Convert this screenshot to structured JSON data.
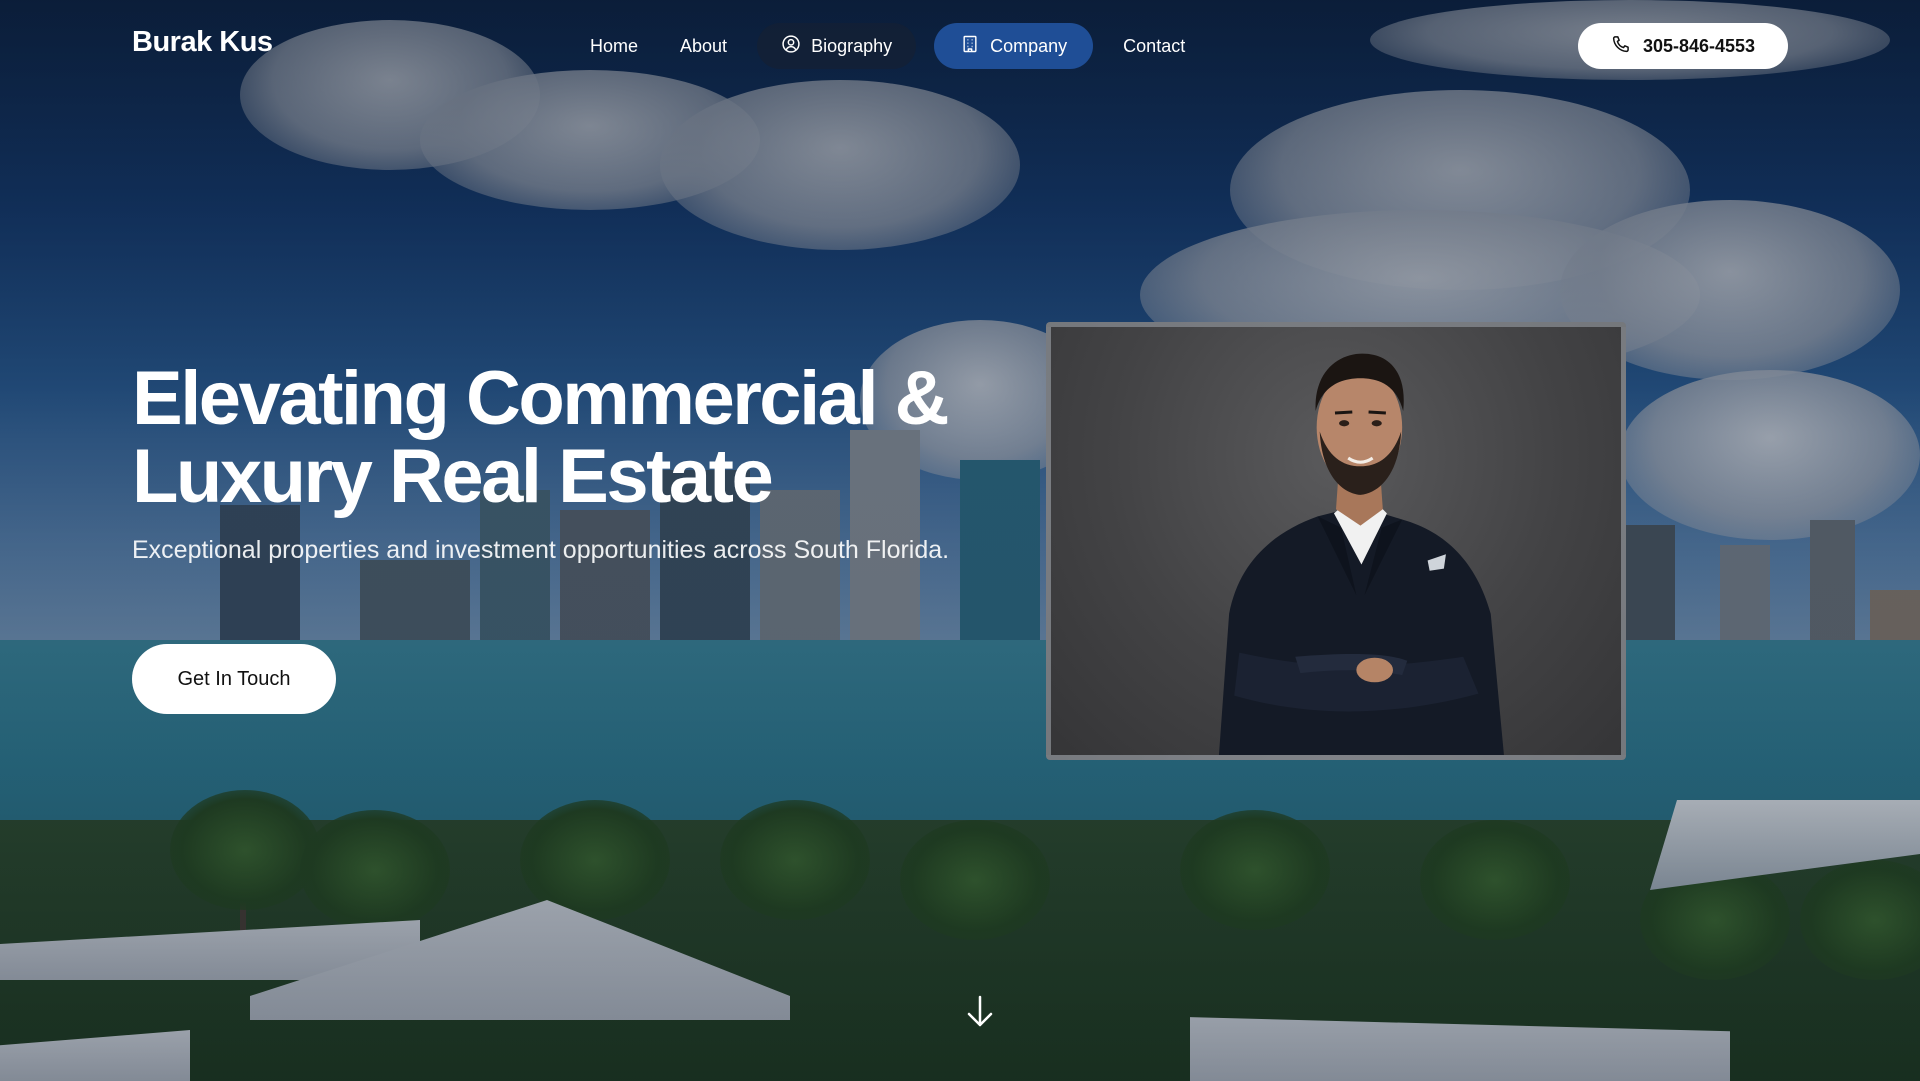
{
  "brand": {
    "name": "Burak Kus"
  },
  "nav": {
    "items": [
      {
        "label": "Home"
      },
      {
        "label": "About"
      },
      {
        "label": "Biography",
        "icon": "user-circle-icon"
      },
      {
        "label": "Company",
        "icon": "building-icon",
        "active": true
      },
      {
        "label": "Contact"
      }
    ],
    "phone": {
      "label": "305-846-4553",
      "icon": "phone-icon"
    }
  },
  "hero": {
    "title_line1": "Elevating Commercial &",
    "title_line2": "Luxury Real Estate",
    "subtitle": "Exceptional properties and investment opportunities across South Florida.",
    "cta_label": "Get In Touch"
  },
  "scroll": {
    "icon": "arrow-down-icon"
  },
  "colors": {
    "active_nav": "#1f4e96",
    "overlay": "#08142880",
    "button_bg": "#ffffff"
  }
}
